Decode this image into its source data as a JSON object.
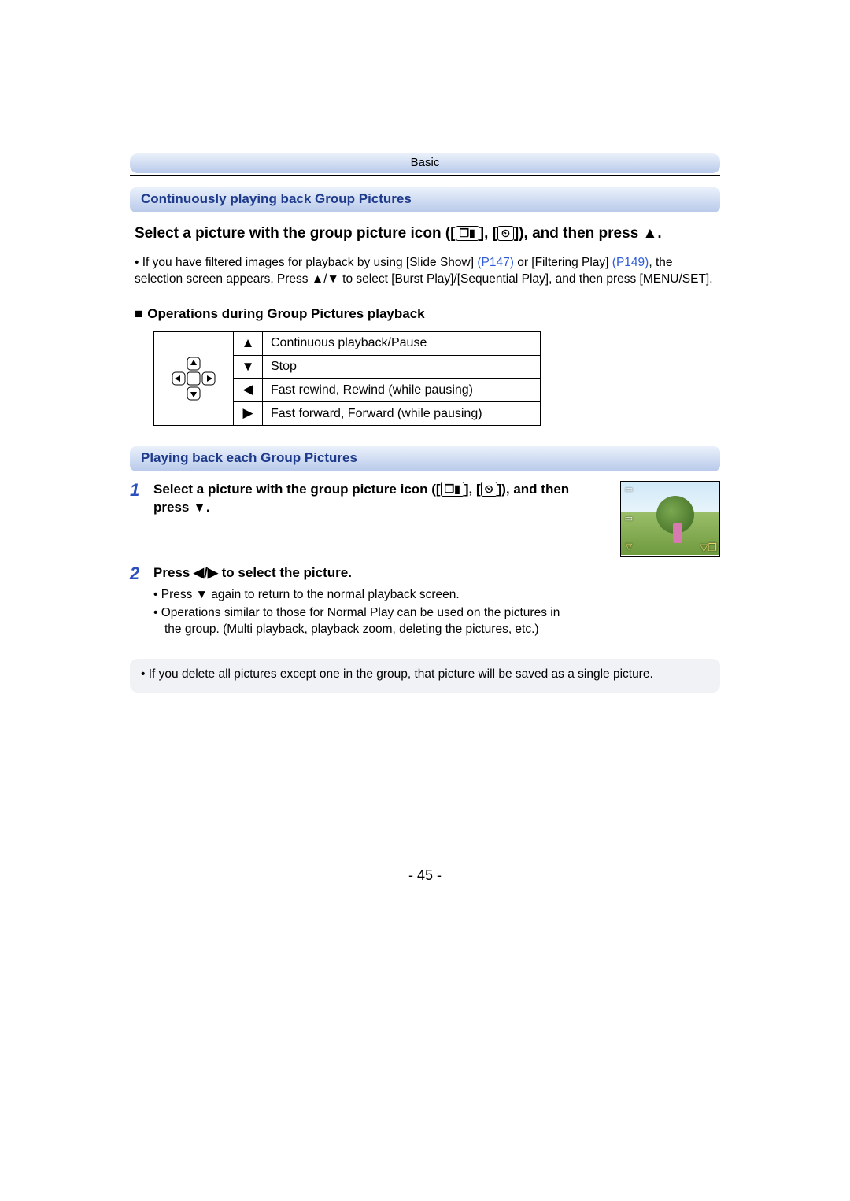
{
  "chapter": "Basic",
  "section1_title": "Continuously playing back Group Pictures",
  "main_instruction": {
    "pre": "Select a picture with the group picture icon ([",
    "mid": "], [",
    "post": "]), and then press ▲."
  },
  "filter_note": {
    "pre": "• If you have filtered images for playback by using [Slide Show] ",
    "link1": "(P147)",
    "mid1": " or [Filtering Play] ",
    "link2": "(P149)",
    "post": ", the selection screen appears. Press ▲/▼ to select [Burst Play]/[Sequential Play], and then press [MENU/SET]."
  },
  "ops_heading": "Operations during Group Pictures playback",
  "ops": [
    {
      "arrow": "▲",
      "desc": "Continuous playback/Pause"
    },
    {
      "arrow": "▼",
      "desc": "Stop"
    },
    {
      "arrow": "◀",
      "desc": "Fast rewind, Rewind (while pausing)"
    },
    {
      "arrow": "▶",
      "desc": "Fast forward, Forward (while pausing)"
    }
  ],
  "section2_title": "Playing back each Group Pictures",
  "step1": {
    "num": "1",
    "pre": "Select a picture with the group picture icon ([",
    "mid": "], [",
    "post": "]), and then press ▼."
  },
  "step2": {
    "num": "2",
    "title": "Press ◀/▶ to select the picture.",
    "b1": "• Press ▼ again to return to the normal playback screen.",
    "b2": "• Operations similar to those for Normal Play can be used on the pictures in the group. (Multi playback, playback zoom, deleting the pictures, etc.)"
  },
  "notebox": "• If you delete all pictures except one in the group, that picture will be saved as a single picture.",
  "page_number": "- 45 -",
  "icons": {
    "burst_label": "❐▮",
    "timer_label": "⏲"
  }
}
